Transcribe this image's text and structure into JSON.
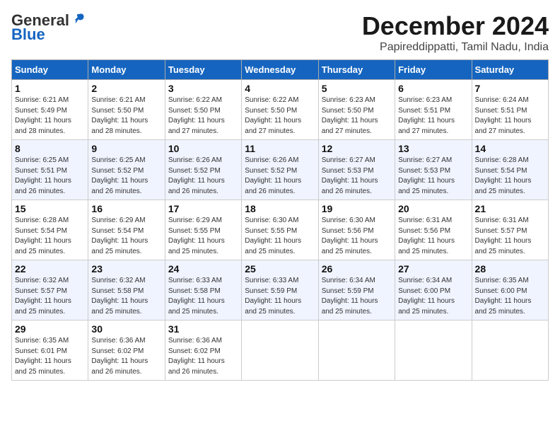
{
  "logo": {
    "general": "General",
    "blue": "Blue"
  },
  "title": "December 2024",
  "subtitle": "Papireddippatti, Tamil Nadu, India",
  "weekdays": [
    "Sunday",
    "Monday",
    "Tuesday",
    "Wednesday",
    "Thursday",
    "Friday",
    "Saturday"
  ],
  "weeks": [
    [
      {
        "day": "1",
        "info": "Sunrise: 6:21 AM\nSunset: 5:49 PM\nDaylight: 11 hours\nand 28 minutes."
      },
      {
        "day": "2",
        "info": "Sunrise: 6:21 AM\nSunset: 5:50 PM\nDaylight: 11 hours\nand 28 minutes."
      },
      {
        "day": "3",
        "info": "Sunrise: 6:22 AM\nSunset: 5:50 PM\nDaylight: 11 hours\nand 27 minutes."
      },
      {
        "day": "4",
        "info": "Sunrise: 6:22 AM\nSunset: 5:50 PM\nDaylight: 11 hours\nand 27 minutes."
      },
      {
        "day": "5",
        "info": "Sunrise: 6:23 AM\nSunset: 5:50 PM\nDaylight: 11 hours\nand 27 minutes."
      },
      {
        "day": "6",
        "info": "Sunrise: 6:23 AM\nSunset: 5:51 PM\nDaylight: 11 hours\nand 27 minutes."
      },
      {
        "day": "7",
        "info": "Sunrise: 6:24 AM\nSunset: 5:51 PM\nDaylight: 11 hours\nand 27 minutes."
      }
    ],
    [
      {
        "day": "8",
        "info": "Sunrise: 6:25 AM\nSunset: 5:51 PM\nDaylight: 11 hours\nand 26 minutes."
      },
      {
        "day": "9",
        "info": "Sunrise: 6:25 AM\nSunset: 5:52 PM\nDaylight: 11 hours\nand 26 minutes."
      },
      {
        "day": "10",
        "info": "Sunrise: 6:26 AM\nSunset: 5:52 PM\nDaylight: 11 hours\nand 26 minutes."
      },
      {
        "day": "11",
        "info": "Sunrise: 6:26 AM\nSunset: 5:52 PM\nDaylight: 11 hours\nand 26 minutes."
      },
      {
        "day": "12",
        "info": "Sunrise: 6:27 AM\nSunset: 5:53 PM\nDaylight: 11 hours\nand 26 minutes."
      },
      {
        "day": "13",
        "info": "Sunrise: 6:27 AM\nSunset: 5:53 PM\nDaylight: 11 hours\nand 25 minutes."
      },
      {
        "day": "14",
        "info": "Sunrise: 6:28 AM\nSunset: 5:54 PM\nDaylight: 11 hours\nand 25 minutes."
      }
    ],
    [
      {
        "day": "15",
        "info": "Sunrise: 6:28 AM\nSunset: 5:54 PM\nDaylight: 11 hours\nand 25 minutes."
      },
      {
        "day": "16",
        "info": "Sunrise: 6:29 AM\nSunset: 5:54 PM\nDaylight: 11 hours\nand 25 minutes."
      },
      {
        "day": "17",
        "info": "Sunrise: 6:29 AM\nSunset: 5:55 PM\nDaylight: 11 hours\nand 25 minutes."
      },
      {
        "day": "18",
        "info": "Sunrise: 6:30 AM\nSunset: 5:55 PM\nDaylight: 11 hours\nand 25 minutes."
      },
      {
        "day": "19",
        "info": "Sunrise: 6:30 AM\nSunset: 5:56 PM\nDaylight: 11 hours\nand 25 minutes."
      },
      {
        "day": "20",
        "info": "Sunrise: 6:31 AM\nSunset: 5:56 PM\nDaylight: 11 hours\nand 25 minutes."
      },
      {
        "day": "21",
        "info": "Sunrise: 6:31 AM\nSunset: 5:57 PM\nDaylight: 11 hours\nand 25 minutes."
      }
    ],
    [
      {
        "day": "22",
        "info": "Sunrise: 6:32 AM\nSunset: 5:57 PM\nDaylight: 11 hours\nand 25 minutes."
      },
      {
        "day": "23",
        "info": "Sunrise: 6:32 AM\nSunset: 5:58 PM\nDaylight: 11 hours\nand 25 minutes."
      },
      {
        "day": "24",
        "info": "Sunrise: 6:33 AM\nSunset: 5:58 PM\nDaylight: 11 hours\nand 25 minutes."
      },
      {
        "day": "25",
        "info": "Sunrise: 6:33 AM\nSunset: 5:59 PM\nDaylight: 11 hours\nand 25 minutes."
      },
      {
        "day": "26",
        "info": "Sunrise: 6:34 AM\nSunset: 5:59 PM\nDaylight: 11 hours\nand 25 minutes."
      },
      {
        "day": "27",
        "info": "Sunrise: 6:34 AM\nSunset: 6:00 PM\nDaylight: 11 hours\nand 25 minutes."
      },
      {
        "day": "28",
        "info": "Sunrise: 6:35 AM\nSunset: 6:00 PM\nDaylight: 11 hours\nand 25 minutes."
      }
    ],
    [
      {
        "day": "29",
        "info": "Sunrise: 6:35 AM\nSunset: 6:01 PM\nDaylight: 11 hours\nand 25 minutes."
      },
      {
        "day": "30",
        "info": "Sunrise: 6:36 AM\nSunset: 6:02 PM\nDaylight: 11 hours\nand 26 minutes."
      },
      {
        "day": "31",
        "info": "Sunrise: 6:36 AM\nSunset: 6:02 PM\nDaylight: 11 hours\nand 26 minutes."
      },
      {
        "day": "",
        "info": ""
      },
      {
        "day": "",
        "info": ""
      },
      {
        "day": "",
        "info": ""
      },
      {
        "day": "",
        "info": ""
      }
    ]
  ]
}
